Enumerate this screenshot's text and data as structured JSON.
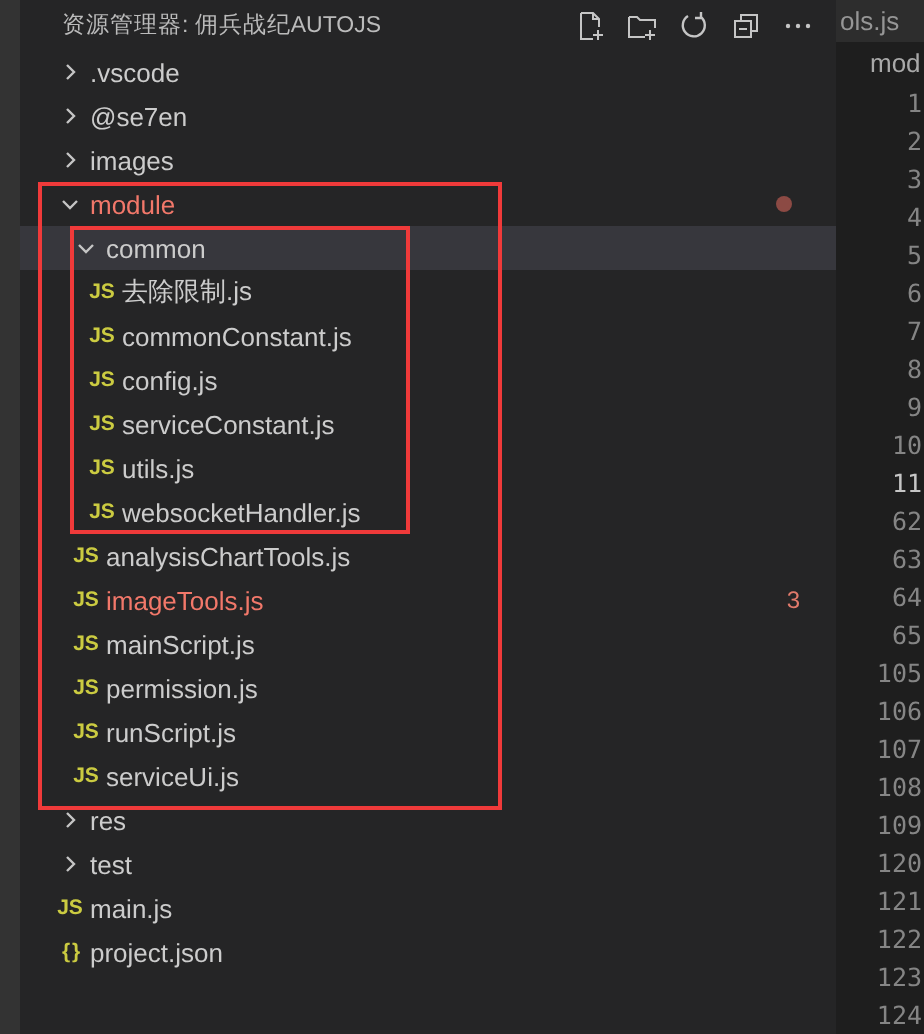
{
  "explorer": {
    "title": "资源管理器: 佣兵战纪AUTOJS",
    "tree": [
      {
        "kind": "folder",
        "name": ".vscode",
        "expanded": false,
        "selected": false,
        "problem": false,
        "outlined": false
      },
      {
        "kind": "folder",
        "name": "@se7en",
        "expanded": false,
        "selected": false,
        "problem": false,
        "outlined": false
      },
      {
        "kind": "folder",
        "name": "images",
        "expanded": false,
        "selected": false,
        "problem": false,
        "outlined": false
      },
      {
        "kind": "folder",
        "name": "module",
        "expanded": true,
        "selected": false,
        "problem": true,
        "outlined": true,
        "dot": true,
        "children": [
          {
            "kind": "folder",
            "name": "common",
            "expanded": true,
            "selected": true,
            "problem": false,
            "outlined": true,
            "children": [
              {
                "kind": "file",
                "icon": "JS",
                "name": "去除限制.js",
                "selected": false,
                "problem": false,
                "outlined": false
              },
              {
                "kind": "file",
                "icon": "JS",
                "name": "commonConstant.js",
                "selected": false,
                "problem": false,
                "outlined": false
              },
              {
                "kind": "file",
                "icon": "JS",
                "name": "config.js",
                "selected": false,
                "problem": false,
                "outlined": false
              },
              {
                "kind": "file",
                "icon": "JS",
                "name": "serviceConstant.js",
                "selected": false,
                "problem": false,
                "outlined": false
              },
              {
                "kind": "file",
                "icon": "JS",
                "name": "utils.js",
                "selected": false,
                "problem": false,
                "outlined": false
              },
              {
                "kind": "file",
                "icon": "JS",
                "name": "websocketHandler.js",
                "selected": false,
                "problem": false,
                "outlined": false
              }
            ]
          },
          {
            "kind": "file",
            "icon": "JS",
            "name": "analysisChartTools.js",
            "selected": false,
            "problem": false,
            "outlined": false
          },
          {
            "kind": "file",
            "icon": "JS",
            "name": "imageTools.js",
            "selected": false,
            "problem": true,
            "outlined": false,
            "badge": "3"
          },
          {
            "kind": "file",
            "icon": "JS",
            "name": "mainScript.js",
            "selected": false,
            "problem": false,
            "outlined": false
          },
          {
            "kind": "file",
            "icon": "JS",
            "name": "permission.js",
            "selected": false,
            "problem": false,
            "outlined": false
          },
          {
            "kind": "file",
            "icon": "JS",
            "name": "runScript.js",
            "selected": false,
            "problem": false,
            "outlined": false
          },
          {
            "kind": "file",
            "icon": "JS",
            "name": "serviceUi.js",
            "selected": false,
            "problem": false,
            "outlined": false
          }
        ]
      },
      {
        "kind": "folder",
        "name": "res",
        "expanded": false,
        "selected": false,
        "problem": false,
        "outlined": false
      },
      {
        "kind": "folder",
        "name": "test",
        "expanded": false,
        "selected": false,
        "problem": false,
        "outlined": false
      },
      {
        "kind": "file",
        "icon": "JS",
        "name": "main.js",
        "selected": false,
        "problem": false,
        "outlined": false
      },
      {
        "kind": "file",
        "icon": "{ }",
        "name": "project.json",
        "selected": false,
        "problem": false,
        "outlined": false
      }
    ]
  },
  "editor": {
    "tab": "ols.js",
    "breadcrumb": "mod",
    "line_numbers": [
      {
        "text": "1",
        "current": false
      },
      {
        "text": "2",
        "current": false
      },
      {
        "text": "3",
        "current": false
      },
      {
        "text": "4",
        "current": false
      },
      {
        "text": "5",
        "current": false
      },
      {
        "text": "6",
        "current": false
      },
      {
        "text": "7",
        "current": false
      },
      {
        "text": "8",
        "current": false
      },
      {
        "text": "9",
        "current": false
      },
      {
        "text": "10",
        "current": false
      },
      {
        "text": "11",
        "current": true
      },
      {
        "text": "62",
        "current": false
      },
      {
        "text": "63",
        "current": false
      },
      {
        "text": "64",
        "current": false
      },
      {
        "text": "65",
        "current": false
      },
      {
        "text": "105",
        "current": false
      },
      {
        "text": "106",
        "current": false
      },
      {
        "text": "107",
        "current": false
      },
      {
        "text": "108",
        "current": false
      },
      {
        "text": "109",
        "current": false
      },
      {
        "text": "120",
        "current": false
      },
      {
        "text": "121",
        "current": false
      },
      {
        "text": "122",
        "current": false
      },
      {
        "text": "123",
        "current": false
      },
      {
        "text": "124",
        "current": false
      }
    ]
  }
}
